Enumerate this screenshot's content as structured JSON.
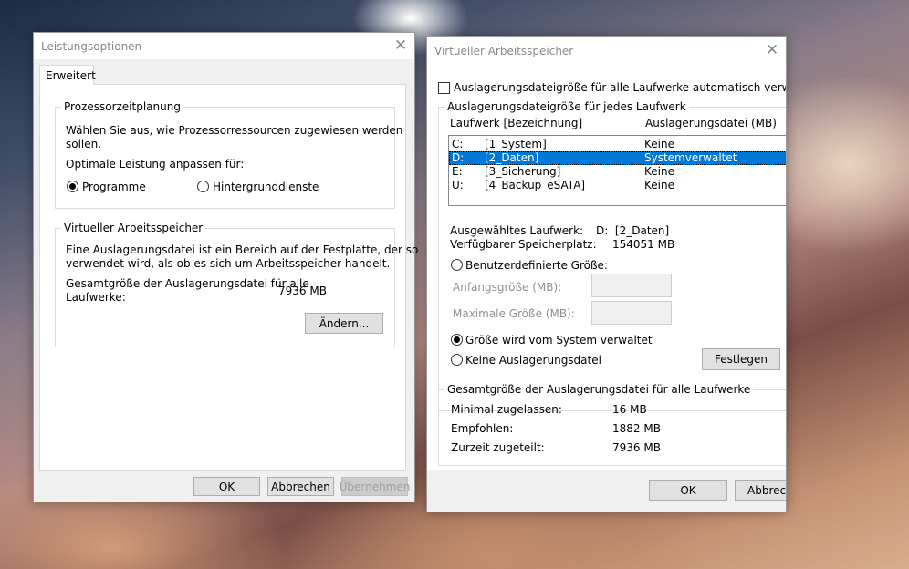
{
  "leistung": {
    "title": "Leistungsoptionen",
    "tab": "Erweitert",
    "proc": {
      "title": "Prozessorzeitplanung",
      "desc1": "Wählen Sie aus, wie Prozessorressourcen zugewiesen werden",
      "desc2": "sollen.",
      "optimize": "Optimale Leistung anpassen für:",
      "opt_programs": "Programme",
      "opt_background": "Hintergrunddienste"
    },
    "vm": {
      "title": "Virtueller Arbeitsspeicher",
      "desc1": "Eine Auslagerungsdatei ist ein Bereich auf der Festplatte, der so",
      "desc2": "verwendet wird, als ob es sich um Arbeitsspeicher handelt.",
      "total_label1": "Gesamtgröße der Auslagerungsdatei für alle",
      "total_label2": "Laufwerke:",
      "total_value": "7936 MB",
      "change": "Ändern..."
    },
    "ok": "OK",
    "cancel": "Abbrechen",
    "apply": "Übernehmen"
  },
  "virtuell": {
    "title": "Virtueller Arbeitsspeicher",
    "auto_label": "Auslagerungsdateigröße für alle Laufwerke automatisch verwalten",
    "auto_checked": false,
    "per_drive_title": "Auslagerungsdateigröße für jedes Laufwerk",
    "col_drive": "Laufwerk [Bezeichnung]",
    "col_file": "Auslagerungsdatei (MB)",
    "drives": [
      {
        "letter": "C:",
        "label": "[1_System]",
        "file": "Keine",
        "selected": false
      },
      {
        "letter": "D:",
        "label": "[2_Daten]",
        "file": "Systemverwaltet",
        "selected": true
      },
      {
        "letter": "E:",
        "label": "[3_Sicherung]",
        "file": "Keine",
        "selected": false
      },
      {
        "letter": "U:",
        "label": "[4_Backup_eSATA]",
        "file": "Keine",
        "selected": false
      }
    ],
    "selected_label": "Ausgewähltes Laufwerk:",
    "selected_value": "D:  [2_Daten]",
    "free_label": "Verfügbarer Speicherplatz:",
    "free_value": "154051 MB",
    "custom_size": "Benutzerdefinierte Größe:",
    "initial_label": "Anfangsgröße (MB):",
    "initial_value": "",
    "max_label": "Maximale Größe (MB):",
    "max_value": "",
    "system_managed": "Größe wird vom System verwaltet",
    "no_paging": "Keine Auslagerungsdatei",
    "set": "Festlegen",
    "total_title": "Gesamtgröße der Auslagerungsdatei für alle Laufwerke",
    "min_label": "Minimal zugelassen:",
    "min_value": "16 MB",
    "rec_label": "Empfohlen:",
    "rec_value": "1882 MB",
    "cur_label": "Zurzeit zugeteilt:",
    "cur_value": "7936 MB",
    "ok": "OK",
    "cancel": "Abbrech"
  }
}
